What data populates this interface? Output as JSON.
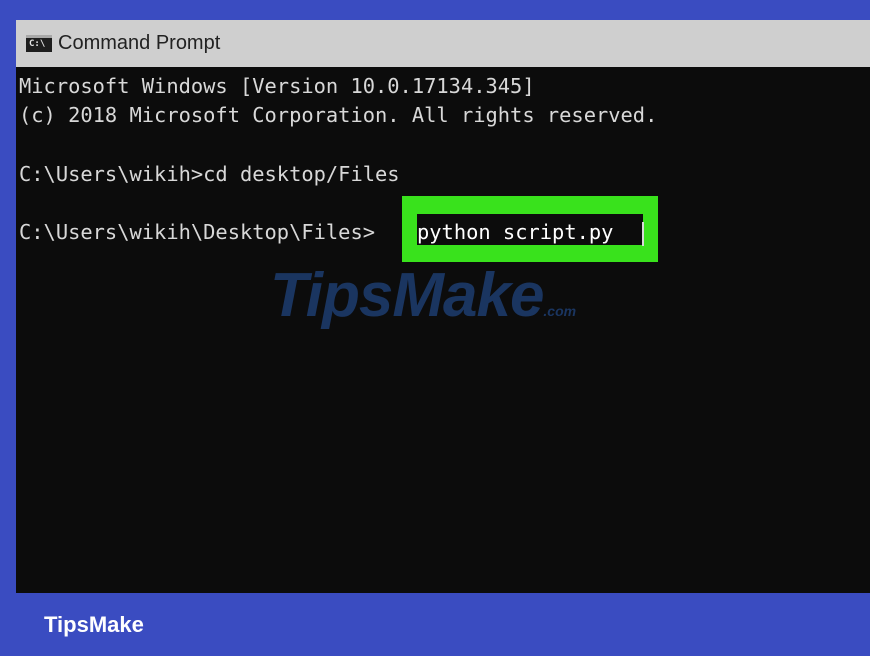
{
  "window": {
    "title": "Command Prompt",
    "icon": "console-app-icon",
    "icon_glyph": "C:\\"
  },
  "console": {
    "lines": [
      "Microsoft Windows [Version 10.0.17134.345]",
      "(c) 2018 Microsoft Corporation. All rights reserved.",
      "C:\\Users\\wikih>cd desktop/Files",
      "C:\\Users\\wikih\\Desktop\\Files>"
    ],
    "current_command": "python script.py",
    "highlight_color": "#39e21c"
  },
  "watermark": {
    "text": "TipsMake",
    "suffix": ".com"
  },
  "footer": {
    "brand": "TipsMake"
  },
  "colors": {
    "background": "#3a4cc1",
    "console_bg": "#0c0c0c",
    "console_text": "#d8d8d8",
    "titlebar": "#cfcfcf"
  }
}
